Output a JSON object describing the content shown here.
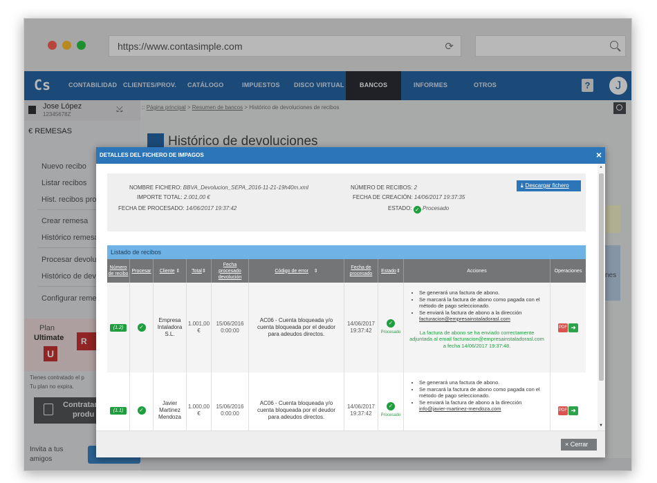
{
  "browser": {
    "url": "https://www.contasimple.com",
    "dots": [
      "#ff5f57",
      "#ffbd2e",
      "#28c840"
    ]
  },
  "nav": {
    "logo": "Cs",
    "items": [
      "CONTABILIDAD",
      "CLIENTES/PROV.",
      "CATÁLOGO",
      "IMPUESTOS",
      "DISCO VIRTUAL",
      "BANCOS",
      "INFORMES",
      "OTROS"
    ],
    "active": "BANCOS",
    "help": "?",
    "avatar": "J"
  },
  "user": {
    "name": "Jose López",
    "id": "12345678Z"
  },
  "sidebar": {
    "section": "REMESAS",
    "items": [
      "Nuevo recibo",
      "Listar recibos",
      "Hist. recibos pro",
      "Crear remesa",
      "Histórico remesa",
      "Procesar devolu",
      "Histórico de dev",
      "Configurar reme"
    ],
    "plan_label": "Plan",
    "plan_name": "Ultimate",
    "plan_badge": "U",
    "plan_button": "R",
    "expire_1": "Tienes contratado el p",
    "expire_2": "Tu plan no expira.",
    "contract_1": "Contratar",
    "contract_2": "produ",
    "invite_1": "Invita a tus",
    "invite_2": "amigos"
  },
  "breadcrumb": {
    "prefix": "::",
    "home": "Página principal",
    "bancos": "Resumen de bancos",
    "current": "Histórico de devoluciones de recibos"
  },
  "page_title": "Histórico de devoluciones",
  "background_side_text": "nes",
  "modal": {
    "title": "DETALLES DEL FICHERO DE IMPAGOS",
    "close": "×",
    "download": "Descargar fichero",
    "fields": {
      "nombre_label": "NOMBRE FICHERO:",
      "nombre_value": "BBVA_Devolucion_SEPA_2016-11-21-19h40m.xml",
      "importe_label": "IMPORTE TOTAL:",
      "importe_value": "2.001,00 €",
      "fecha_proc_label": "FECHA DE PROCESADO:",
      "fecha_proc_value": "14/06/2017 19:37:42",
      "num_label": "NÚMERO DE RECIBOS:",
      "num_value": "2",
      "fecha_creacion_label": "FECHA DE CREACIÓN:",
      "fecha_creacion_value": "14/06/2017 19:37:35",
      "estado_label": "ESTADO:",
      "estado_value": "Procesado"
    },
    "list_title": "Listado de recibos",
    "columns": [
      "Número de recibo",
      "Procesar",
      "Cliente",
      "Total",
      "Fecha procesado devolución",
      "Código de error",
      "Fecha de procesado",
      "Estado",
      "Acciones",
      "Operaciones"
    ],
    "rows": [
      {
        "numero": "(1.2)",
        "cliente": "Empresa Intaladora S.L.",
        "total": "1.001,00 €",
        "fecha_dev": "15/06/2016 0:00:00",
        "error": "AC06 - Cuenta bloqueada y/o cuenta bloqueada por el deudor para adeudos directos.",
        "fecha_proc": "14/06/2017 19:37:42",
        "estado": "Procesado",
        "acciones": [
          "Se generará una factura de abono.",
          "Se marcará la factura de abono como pagada con el método de pago seleccionado.",
          "Se enviará la factura de abono a la dirección"
        ],
        "email": "facturacion@empresainstaladorasl.com",
        "mensaje": "La factura de abono se ha enviado correctamente adjuntada al email facturacion@empresainstaladorasl.com a fecha 14/06/2017 19:37:48."
      },
      {
        "numero": "(1.1)",
        "cliente": "Javier Martinez Mendoza",
        "total": "1.000,00 €",
        "fecha_dev": "15/06/2016 0:00:00",
        "error": "AC06 - Cuenta bloqueada y/o cuenta bloqueada por el deudor para adeudos directos.",
        "fecha_proc": "14/06/2017 19:37:42",
        "estado": "Procesado",
        "acciones": [
          "Se generará una factura de abono.",
          "Se marcará la factura de abono como pagada con el método de pago seleccionado.",
          "Se enviará la factura de abono a la dirección"
        ],
        "email": "info@javier-martinez-mendoza.com",
        "mensaje": ""
      }
    ],
    "pdf_label": "PDF",
    "close_button": "Cerrar",
    "close_icon": "×"
  }
}
